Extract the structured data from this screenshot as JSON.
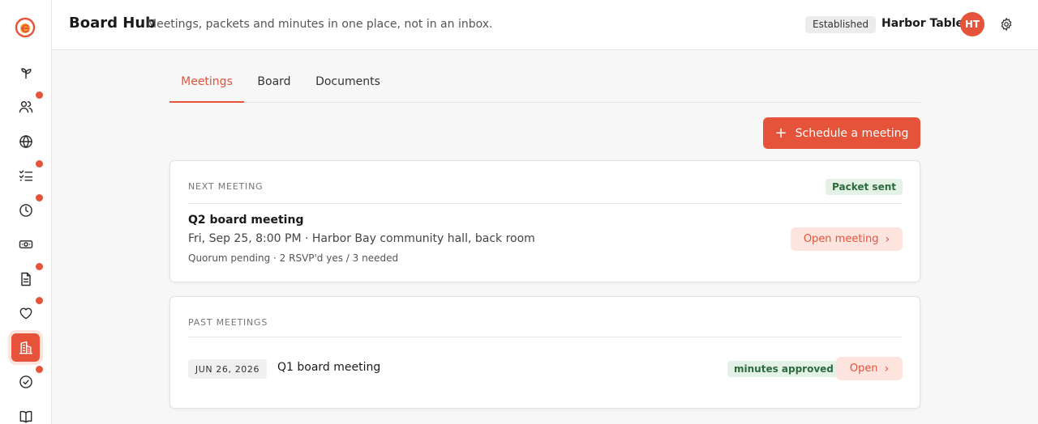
{
  "app": {
    "title": "Board Hub",
    "subtitle": "Meetings, packets and minutes in one place, not in an inbox.",
    "tier_badge": "Established",
    "org_name": "Harbor Table",
    "avatar_initials": "HT",
    "accent_color": "#e5533a"
  },
  "sidebar": {
    "items": [
      {
        "icon": "sprout-icon",
        "notify": false,
        "active": false
      },
      {
        "icon": "users-icon",
        "notify": true,
        "active": false
      },
      {
        "icon": "globe-icon",
        "notify": false,
        "active": false
      },
      {
        "icon": "checklist-icon",
        "notify": true,
        "active": false
      },
      {
        "icon": "clock-icon",
        "notify": true,
        "active": false
      },
      {
        "icon": "money-icon",
        "notify": false,
        "active": false
      },
      {
        "icon": "document-icon",
        "notify": true,
        "active": false
      },
      {
        "icon": "heart-icon",
        "notify": true,
        "active": false
      },
      {
        "icon": "building-icon",
        "notify": false,
        "active": true
      },
      {
        "icon": "check-circle-icon",
        "notify": true,
        "active": false
      },
      {
        "icon": "book-icon",
        "notify": false,
        "active": false
      }
    ]
  },
  "tabs": [
    {
      "label": "Meetings",
      "active": true
    },
    {
      "label": "Board",
      "active": false
    },
    {
      "label": "Documents",
      "active": false
    }
  ],
  "actions": {
    "schedule_label": "Schedule a meeting"
  },
  "next_meeting": {
    "section_label": "NEXT MEETING",
    "status_badge": "Packet sent",
    "title": "Q2 board meeting",
    "when": "Fri, Sep 25, 8:00 PM · Harbor Bay community hall, back room",
    "quorum": "Quorum pending · 2 RSVP'd yes / 3 needed",
    "open_label": "Open meeting"
  },
  "past_meetings": {
    "section_label": "PAST MEETINGS",
    "rows": [
      {
        "date": "JUN 26, 2026",
        "title": "Q1 board meeting",
        "status_badge": "minutes approved",
        "open_label": "Open"
      }
    ]
  }
}
